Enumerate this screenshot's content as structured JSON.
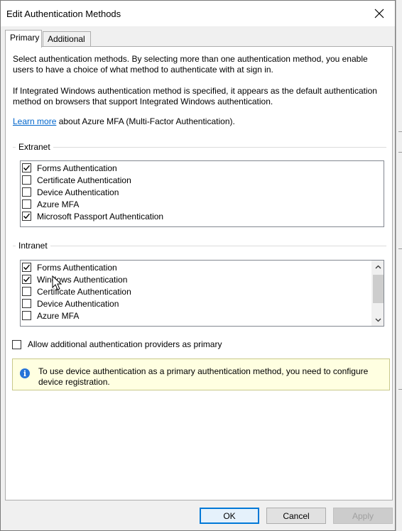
{
  "dialog": {
    "title": "Edit Authentication Methods",
    "close_icon": "close-icon"
  },
  "tabs": [
    {
      "label": "Primary",
      "active": true
    },
    {
      "label": "Additional",
      "active": false
    }
  ],
  "description": {
    "p1": "Select authentication methods. By selecting more than one authentication method, you enable users to have a choice of what method to authenticate with at sign in.",
    "p2": "If Integrated Windows authentication method is specified, it appears as the default authentication method on browsers that support Integrated Windows authentication.",
    "learn_more_link": "Learn more",
    "learn_more_suffix": " about Azure MFA (Multi-Factor Authentication)."
  },
  "extranet": {
    "label": "Extranet",
    "items": [
      {
        "label": "Forms Authentication",
        "checked": true
      },
      {
        "label": "Certificate Authentication",
        "checked": false
      },
      {
        "label": "Device Authentication",
        "checked": false
      },
      {
        "label": "Azure MFA",
        "checked": false
      },
      {
        "label": "Microsoft Passport Authentication",
        "checked": true
      }
    ]
  },
  "intranet": {
    "label": "Intranet",
    "items": [
      {
        "label": "Forms Authentication",
        "checked": true
      },
      {
        "label": "Windows Authentication",
        "checked": true
      },
      {
        "label": "Certificate Authentication",
        "checked": false
      },
      {
        "label": "Device Authentication",
        "checked": false
      },
      {
        "label": "Azure MFA",
        "checked": false
      }
    ]
  },
  "allow_additional": {
    "label": "Allow additional authentication providers as primary",
    "checked": false
  },
  "info": {
    "icon": "info-icon",
    "text": "To use device authentication as a primary authentication method, you need to configure device registration."
  },
  "buttons": {
    "ok": "OK",
    "cancel": "Cancel",
    "apply": "Apply"
  },
  "colors": {
    "link": "#0066cc",
    "accent": "#0078d7",
    "info_bg": "#ffffe1",
    "info_icon": "#2673d8"
  }
}
